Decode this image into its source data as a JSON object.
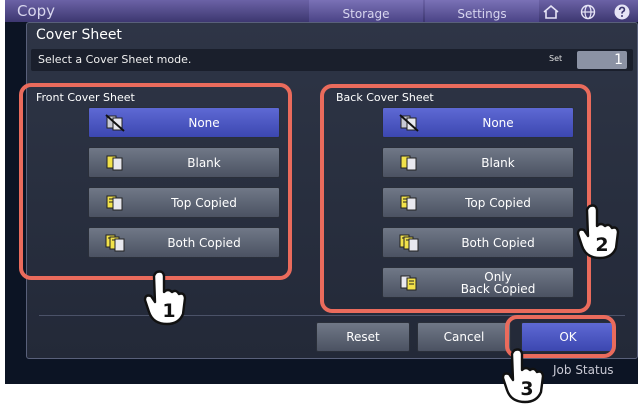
{
  "top_bar": {
    "app_title": "Copy",
    "tabs": [
      {
        "label": "Storage"
      },
      {
        "label": "Settings"
      }
    ],
    "icons": [
      "home-icon",
      "globe-icon",
      "help-icon"
    ]
  },
  "bottom_bar": {
    "job_status": "Job Status"
  },
  "dialog": {
    "title": "Cover Sheet",
    "prompt": "Select a Cover Sheet mode.",
    "set_label": "Set",
    "set_value": "1",
    "front": {
      "label": "Front Cover Sheet",
      "options": [
        {
          "label": "None",
          "selected": true,
          "icon": "no-cover-icon"
        },
        {
          "label": "Blank",
          "selected": false,
          "icon": "blank-cover-icon"
        },
        {
          "label": "Top Copied",
          "selected": false,
          "icon": "top-copied-icon"
        },
        {
          "label": "Both Copied",
          "selected": false,
          "icon": "both-copied-icon"
        }
      ]
    },
    "back": {
      "label": "Back Cover Sheet",
      "options": [
        {
          "label": "None",
          "selected": true,
          "icon": "no-cover-icon"
        },
        {
          "label": "Blank",
          "selected": false,
          "icon": "blank-cover-icon"
        },
        {
          "label": "Top Copied",
          "selected": false,
          "icon": "top-copied-icon"
        },
        {
          "label": "Both Copied",
          "selected": false,
          "icon": "both-copied-icon"
        },
        {
          "label": "Only\nBack Copied",
          "selected": false,
          "icon": "only-back-copied-icon"
        }
      ]
    },
    "buttons": {
      "reset": "Reset",
      "cancel": "Cancel",
      "ok": "OK"
    }
  },
  "annotations": {
    "step_1": "1",
    "step_2": "2",
    "step_3": "3",
    "color": "#ea6b5c"
  },
  "colors": {
    "selected": "#4a55c4",
    "button": "#5f6676",
    "topbar": "#544b8f"
  }
}
